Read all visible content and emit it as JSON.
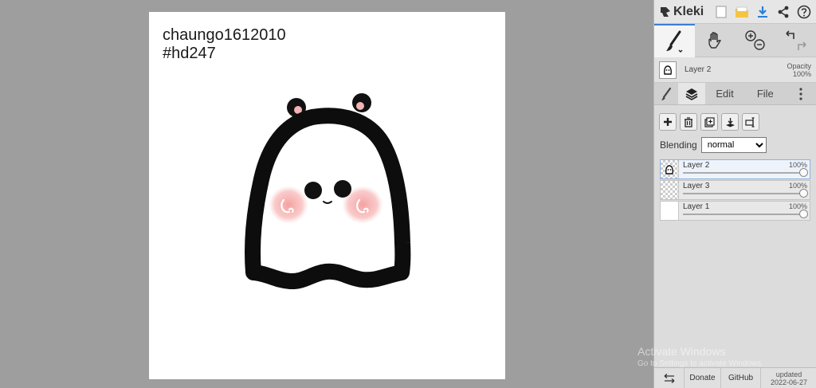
{
  "canvas": {
    "caption_line1": "chaungo1612010",
    "caption_line2": "#hd247"
  },
  "app": {
    "name": "Kleki"
  },
  "current_layer": {
    "name": "Layer 2",
    "opacity_label": "Opacity",
    "opacity_value": "100%"
  },
  "tabs": {
    "edit": "Edit",
    "file": "File"
  },
  "blending": {
    "label": "Blending",
    "selected": "normal"
  },
  "layers": [
    {
      "name": "Layer 2",
      "opacity": "100%"
    },
    {
      "name": "Layer 3",
      "opacity": "100%"
    },
    {
      "name": "Layer 1",
      "opacity": "100%"
    }
  ],
  "watermark": {
    "line1": "Activate Windows",
    "line2": "Go to Settings to activate Windows."
  },
  "footer": {
    "donate": "Donate",
    "github": "GitHub",
    "updated_label": "updated",
    "updated_date": "2022-06-27"
  },
  "colors": {
    "accent": "#3b7dd8",
    "workspace_bg": "#9e9e9e",
    "blush": "#f4a6a6"
  }
}
